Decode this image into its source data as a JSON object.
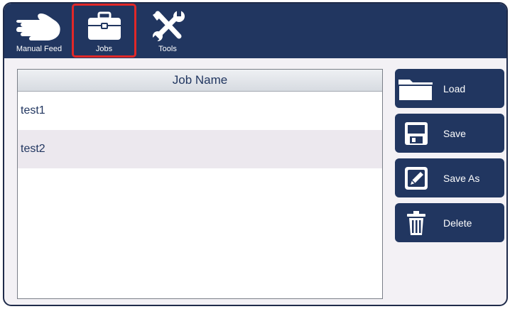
{
  "tabs": {
    "manual_feed": "Manual Feed",
    "jobs": "Jobs",
    "tools": "Tools"
  },
  "list": {
    "header": "Job Name",
    "rows": [
      "test1",
      "test2"
    ]
  },
  "actions": {
    "load": "Load",
    "save": "Save",
    "save_as": "Save As",
    "delete": "Delete"
  },
  "colors": {
    "primary": "#213660",
    "selected_outline": "#e12828",
    "row_alt": "#ece8ee"
  }
}
